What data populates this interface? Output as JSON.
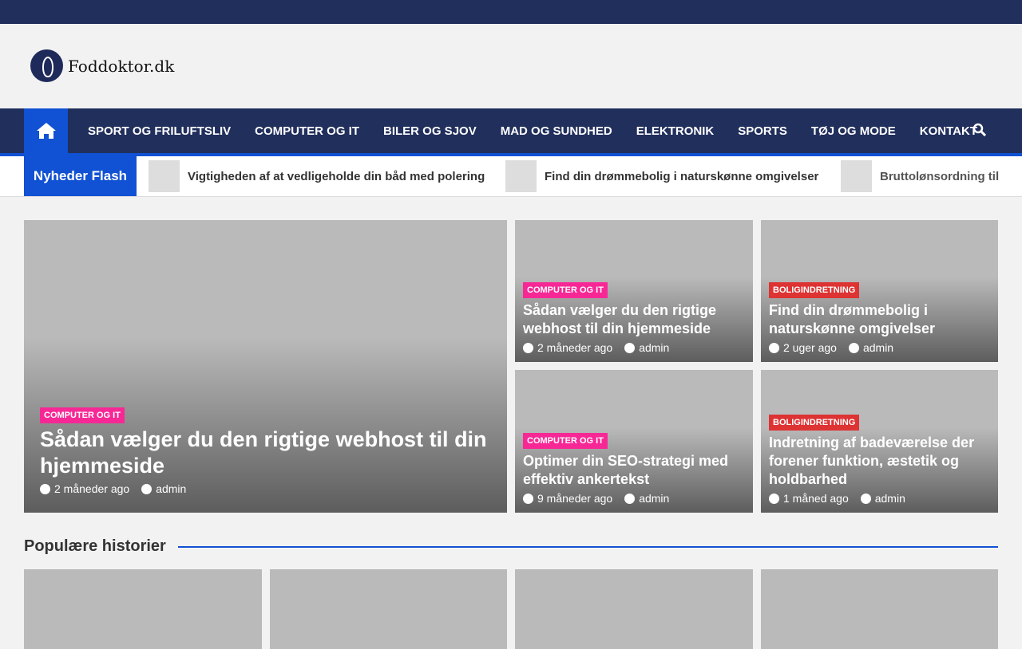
{
  "site": {
    "name": "Foddoktor.dk"
  },
  "nav": {
    "items": [
      "SPORT OG FRILUFTSLIV",
      "COMPUTER OG IT",
      "BILER OG SJOV",
      "MAD OG SUNDHED",
      "ELEKTRONIK",
      "SPORTS",
      "TØJ OG MODE",
      "KONTAKT"
    ]
  },
  "ticker": {
    "label": "Nyheder Flash",
    "items": [
      "Vigtigheden af at vedligeholde din båd med polering",
      "Find din drømmebolig i naturskønne omgivelser",
      "Bruttolønsordning til"
    ]
  },
  "featured": [
    {
      "category": "COMPUTER OG IT",
      "title": "Sådan vælger du den rigtige webhost til din hjemmeside",
      "time": "2 måneder ago",
      "author": "admin"
    },
    {
      "category": "COMPUTER OG IT",
      "title": "Sådan vælger du den rigtige webhost til din hjemmeside",
      "time": "2 måneder ago",
      "author": "admin"
    },
    {
      "category": "BOLIGINDRETNING",
      "title": "Find din drømmebolig i naturskønne omgivelser",
      "time": "2 uger ago",
      "author": "admin"
    },
    {
      "category": "COMPUTER OG IT",
      "title": "Optimer din SEO-strategi med effektiv ankertekst",
      "time": "9 måneder ago",
      "author": "admin"
    },
    {
      "category": "BOLIGINDRETNING",
      "title": "Indretning af badeværelse der forener funktion, æstetik og holdbarhed",
      "time": "1 måned ago",
      "author": "admin"
    }
  ],
  "popular": {
    "title": "Populære historier"
  },
  "colors": {
    "navy": "#212f5c",
    "blue": "#1151d3",
    "pink": "#f72896",
    "red": "#dd3333"
  }
}
